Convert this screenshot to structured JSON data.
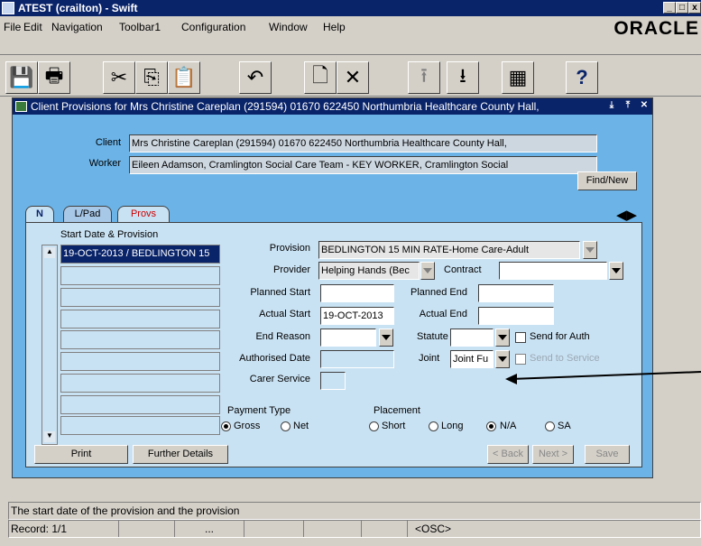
{
  "app": {
    "title": "ATEST (crailton) - Swift",
    "oracle": "ORACLE"
  },
  "menu": {
    "file": "File",
    "edit": "Edit",
    "navigation": "Navigation",
    "toolbar1": "Toolbar1",
    "configuration": "Configuration",
    "window": "Window",
    "help": "Help"
  },
  "toolbar": {
    "help": "?"
  },
  "window": {
    "title": "Client Provisions for Mrs Christine Careplan (291594) 01670 622450 Northumbria Healthcare County Hall,"
  },
  "header": {
    "client_label": "Client",
    "client_value": "Mrs Christine Careplan (291594) 01670 622450 Northumbria Healthcare County Hall,",
    "worker_label": "Worker",
    "worker_value": "Eileen Adamson, Cramlington Social Care Team - KEY WORKER, Cramlington Social",
    "find_new": "Find/New"
  },
  "tabs": {
    "n": "N",
    "lpad": "L/Pad",
    "provs": "Provs"
  },
  "list": {
    "header": "Start Date & Provision",
    "first": "19-OCT-2013 / BEDLINGTON 15"
  },
  "form": {
    "provision_label": "Provision",
    "provision_value": "BEDLINGTON 15 MIN RATE-Home Care-Adult",
    "provider_label": "Provider",
    "provider_value": "Helping Hands (Bec",
    "contract_label": "Contract",
    "planned_start_label": "Planned Start",
    "planned_end_label": "Planned End",
    "actual_start_label": "Actual Start",
    "actual_start_value": "19-OCT-2013",
    "actual_end_label": "Actual End",
    "end_reason_label": "End Reason",
    "statute_label": "Statute",
    "send_auth": "Send for Auth",
    "authorised_label": "Authorised Date",
    "joint_label": "Joint",
    "joint_value": "Joint Fu",
    "send_service": "Send to Service",
    "carer_label": "Carer Service",
    "payment_label": "Payment Type",
    "gross": "Gross",
    "net": "Net",
    "placement_label": "Placement",
    "short": "Short",
    "long": "Long",
    "na": "N/A",
    "sa": "SA"
  },
  "buttons": {
    "print": "Print",
    "further": "Further Details",
    "back": "< Back",
    "next": "Next >",
    "save": "Save"
  },
  "status": {
    "message": "The start date of the provision and the provision",
    "record": "Record: 1/1",
    "dots": "...",
    "osc": "<OSC>"
  }
}
